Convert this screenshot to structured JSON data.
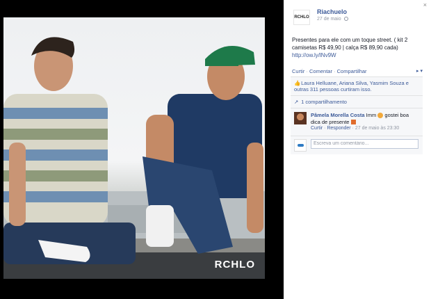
{
  "photo": {
    "brand_watermark": "RCHLO"
  },
  "panel": {
    "close_glyph": "×",
    "page": {
      "logo_text": "RCHLO",
      "name": "Riachuelo",
      "date": "27 de maio",
      "privacy_icon": "globe-icon"
    },
    "post": {
      "text": "Presentes para ele com um toque street. ( kit 2 camisetas R$ 49,90 | calça R$ 89,90 cada)",
      "link": "http://ow.ly/lNv9W"
    },
    "actions": {
      "like": "Curtir",
      "comment": "Comentar",
      "share": "Compartilhar",
      "separator": " · "
    },
    "ufi": {
      "likes_text": "Laura Helluane, Ariana Silva, Yasmim Souza e outras 311 pessoas curtiram isso.",
      "shares_text": "1 compartilhamento",
      "comment": {
        "author": "Pâmela Morella Costa",
        "text_before": "Imm",
        "text_after": "gostei boa dica de presente",
        "like": "Curtir",
        "reply": "Responder",
        "date": "27 de maio às 23:30"
      },
      "composer_placeholder": "Escreva um comentário..."
    }
  },
  "colors": {
    "link_blue": "#3b5998",
    "meta_gray": "#9197a3",
    "stage_black": "#000000"
  }
}
